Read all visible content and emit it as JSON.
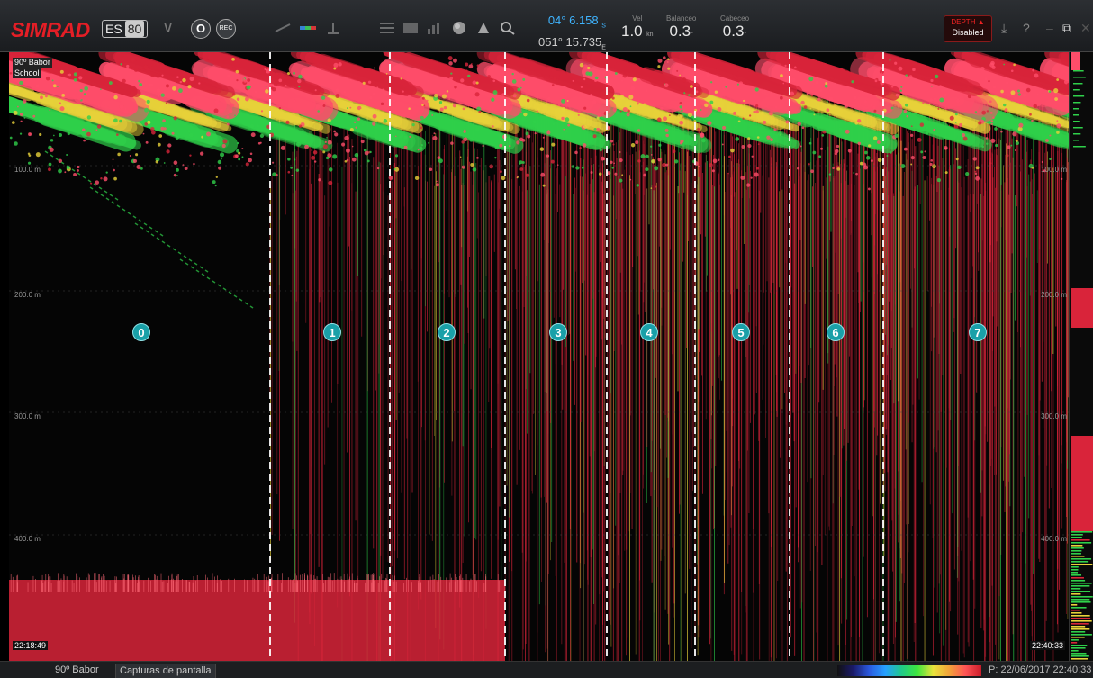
{
  "toolbar": {
    "brand": "SIMRAD",
    "product_prefix": "ES",
    "product_number": "80",
    "btn_o": "O",
    "btn_rec": "REC",
    "latitude": "04° 6.158",
    "lat_suffix": "S",
    "longitude": "051° 15.735",
    "lon_suffix": "E",
    "speed_label": "Vel",
    "speed_value": "1.0",
    "speed_unit": "kn",
    "roll_label": "Balanceo",
    "roll_value": "0.3",
    "roll_unit": "°",
    "pitch_label": "Cabeceo",
    "pitch_value": "0.3",
    "pitch_unit": "°",
    "alarm_title": "DEPTH",
    "alarm_state": "Disabled",
    "help": "?"
  },
  "echogram": {
    "channel": "90º Babor",
    "school": "School",
    "depths_left": [
      "100.0 m",
      "200.0 m",
      "300.0 m",
      "400.0 m"
    ],
    "depths_right": [
      "100.0 m",
      "200.0 m",
      "300.0 m",
      "400.0 m"
    ],
    "time_start": "22:18:49",
    "time_end": "22:40:33",
    "sections": [
      "0",
      "1",
      "2",
      "3",
      "4",
      "5",
      "6",
      "7"
    ]
  },
  "status": {
    "tab_channel": "90º Babor",
    "tab_screens": "Capturas de pantalla",
    "ptime": "P: 22/06/2017  22:40:33"
  },
  "colors": {
    "echo_red": "#d9243a",
    "echo_pink": "#ff4d6a",
    "echo_green": "#2fd04a",
    "echo_yellow": "#e8d23a",
    "section_marker": "#1aa0a8"
  },
  "icons": [
    "chevron-down-icon",
    "transducer-icon",
    "color-scale-icon",
    "bottom-icon",
    "menu-icon",
    "layout-icon",
    "histogram-icon",
    "sphere-icon",
    "beacon-icon",
    "zoom-icon",
    "minimize-icon",
    "restore-icon",
    "close-icon"
  ]
}
